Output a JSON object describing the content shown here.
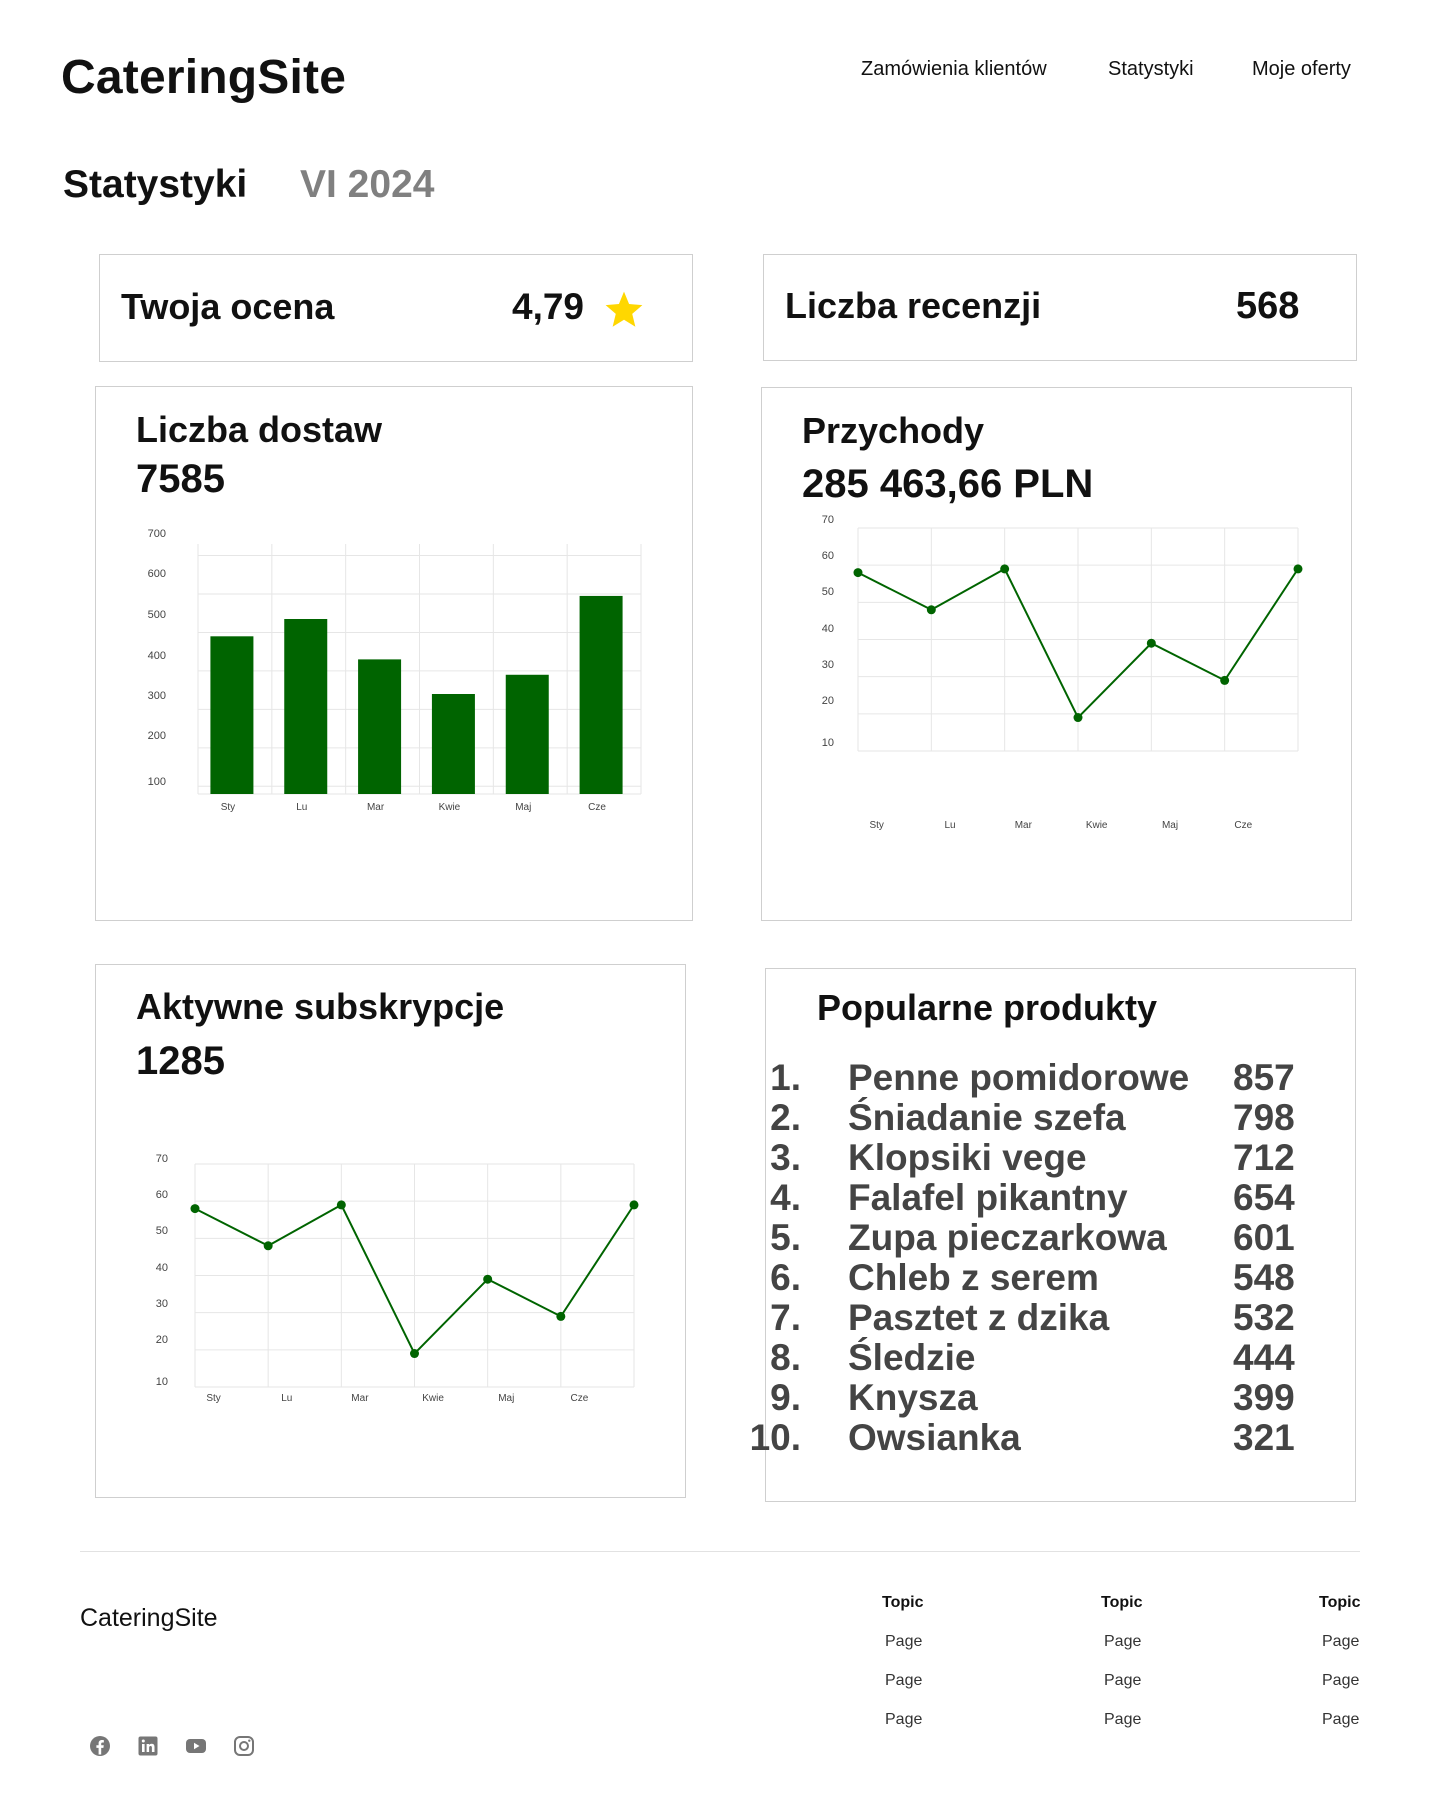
{
  "header": {
    "logo": "CateringSite",
    "nav": [
      "Zamówienia klientów",
      "Statystyki",
      "Moje oferty"
    ]
  },
  "page": {
    "title": "Statystyki",
    "period": "VI 2024"
  },
  "rating_card": {
    "label": "Twoja ocena",
    "value": "4,79",
    "icon": "star-icon",
    "icon_color": "#FFD700"
  },
  "reviews_card": {
    "label": "Liczba recenzji",
    "value": "568"
  },
  "deliveries_card": {
    "label": "Liczba dostaw",
    "value": "7585"
  },
  "revenue_card": {
    "label": "Przychody",
    "value": "285 463,66 PLN"
  },
  "subscriptions_card": {
    "label": "Aktywne subskrypcje",
    "value": "1285"
  },
  "products_card": {
    "label": "Popularne produkty",
    "items": [
      {
        "rank": "1.",
        "name": "Penne pomidorowe",
        "count": "857"
      },
      {
        "rank": "2.",
        "name": "Śniadanie szefa",
        "count": "798"
      },
      {
        "rank": "3.",
        "name": "Klopsiki vege",
        "count": "712"
      },
      {
        "rank": "4.",
        "name": "Falafel pikantny",
        "count": "654"
      },
      {
        "rank": "5.",
        "name": "Zupa pieczarkowa",
        "count": "601"
      },
      {
        "rank": "6.",
        "name": "Chleb z serem",
        "count": "548"
      },
      {
        "rank": "7.",
        "name": "Pasztet z dzika",
        "count": "532"
      },
      {
        "rank": "8.",
        "name": "Śledzie",
        "count": "444"
      },
      {
        "rank": "9.",
        "name": "Knysza",
        "count": "399"
      },
      {
        "rank": "10.",
        "name": "Owsianka",
        "count": "321"
      }
    ]
  },
  "chart_data": [
    {
      "type": "bar",
      "categories": [
        "Sty",
        "Lu",
        "Mar",
        "Kwie",
        "Maj",
        "Cze"
      ],
      "values": [
        490,
        535,
        430,
        340,
        390,
        595
      ],
      "yticks": [
        100,
        200,
        300,
        400,
        500,
        600,
        700
      ],
      "ylim": [
        80,
        730
      ],
      "color": "#006400",
      "grid": true
    },
    {
      "type": "line",
      "categories": [
        "Sty",
        "Lu",
        "Mar",
        "Kwie",
        "Maj",
        "Cze"
      ],
      "x": [
        0,
        1,
        2,
        3,
        4,
        5,
        6
      ],
      "values": [
        58,
        48,
        59,
        19,
        39,
        29,
        59
      ],
      "yticks": [
        10,
        20,
        30,
        40,
        50,
        60,
        70
      ],
      "ylim": [
        10,
        70
      ],
      "color": "#006400",
      "grid": true
    },
    {
      "type": "line",
      "categories": [
        "Sty",
        "Lu",
        "Mar",
        "Kwie",
        "Maj",
        "Cze"
      ],
      "x": [
        0,
        1,
        2,
        3,
        4,
        5,
        6
      ],
      "values": [
        58,
        48,
        59,
        19,
        39,
        29,
        59
      ],
      "yticks": [
        10,
        20,
        30,
        40,
        50,
        60,
        70
      ],
      "ylim": [
        10,
        70
      ],
      "color": "#006400",
      "grid": true
    }
  ],
  "footer": {
    "brand": "CateringSite",
    "columns": [
      {
        "topic": "Topic",
        "pages": [
          "Page",
          "Page",
          "Page"
        ]
      },
      {
        "topic": "Topic",
        "pages": [
          "Page",
          "Page",
          "Page"
        ]
      },
      {
        "topic": "Topic",
        "pages": [
          "Page",
          "Page",
          "Page"
        ]
      }
    ],
    "social_icons": [
      "facebook-icon",
      "linkedin-icon",
      "youtube-icon",
      "instagram-icon"
    ]
  }
}
